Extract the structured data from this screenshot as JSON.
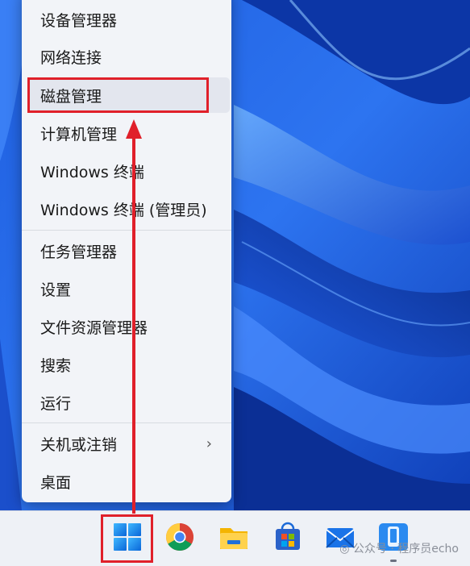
{
  "menu": {
    "items": [
      {
        "label": "设备管理器"
      },
      {
        "label": "网络连接"
      },
      {
        "label": "磁盘管理"
      },
      {
        "label": "计算机管理"
      },
      {
        "label": "Windows 终端"
      },
      {
        "label": "Windows 终端 (管理员)"
      },
      {
        "label": "任务管理器"
      },
      {
        "label": "设置"
      },
      {
        "label": "文件资源管理器"
      },
      {
        "label": "搜索"
      },
      {
        "label": "运行"
      },
      {
        "label": "关机或注销"
      },
      {
        "label": "桌面"
      }
    ],
    "highlighted_item": "磁盘管理"
  },
  "taskbar": {
    "apps": [
      {
        "icon": "windows-start-icon"
      },
      {
        "icon": "chrome-icon"
      },
      {
        "icon": "file-explorer-icon"
      },
      {
        "icon": "microsoft-store-icon"
      },
      {
        "icon": "mail-icon"
      },
      {
        "icon": "phone-link-icon"
      }
    ]
  },
  "watermark": {
    "text": "公众号 · 程序员echo"
  },
  "colors": {
    "annotation_red": "#e0202a",
    "accent_blue": "#2f6fe6"
  }
}
